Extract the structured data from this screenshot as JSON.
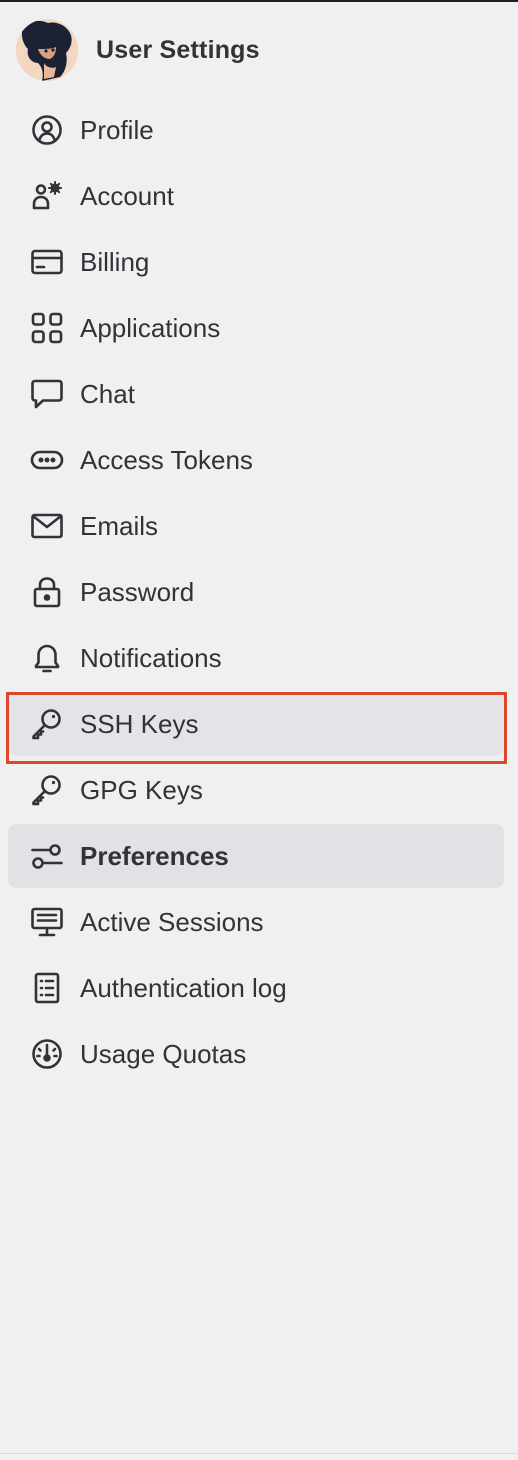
{
  "header": {
    "title": "User Settings"
  },
  "nav": {
    "items": [
      {
        "label": "Profile",
        "icon": "profile-icon"
      },
      {
        "label": "Account",
        "icon": "account-icon"
      },
      {
        "label": "Billing",
        "icon": "billing-icon"
      },
      {
        "label": "Applications",
        "icon": "applications-icon"
      },
      {
        "label": "Chat",
        "icon": "chat-icon"
      },
      {
        "label": "Access Tokens",
        "icon": "token-icon"
      },
      {
        "label": "Emails",
        "icon": "mail-icon"
      },
      {
        "label": "Password",
        "icon": "lock-icon"
      },
      {
        "label": "Notifications",
        "icon": "bell-icon"
      },
      {
        "label": "SSH Keys",
        "icon": "key-icon",
        "highlighted": true
      },
      {
        "label": "GPG Keys",
        "icon": "key-icon"
      },
      {
        "label": "Preferences",
        "icon": "preferences-icon",
        "active": true
      },
      {
        "label": "Active Sessions",
        "icon": "monitor-icon"
      },
      {
        "label": "Authentication log",
        "icon": "log-icon"
      },
      {
        "label": "Usage Quotas",
        "icon": "gauge-icon"
      }
    ]
  },
  "colors": {
    "background": "#f0f0f0",
    "active_bg": "#e1e1e6",
    "highlight_border": "#e0442a",
    "text": "#333238"
  }
}
